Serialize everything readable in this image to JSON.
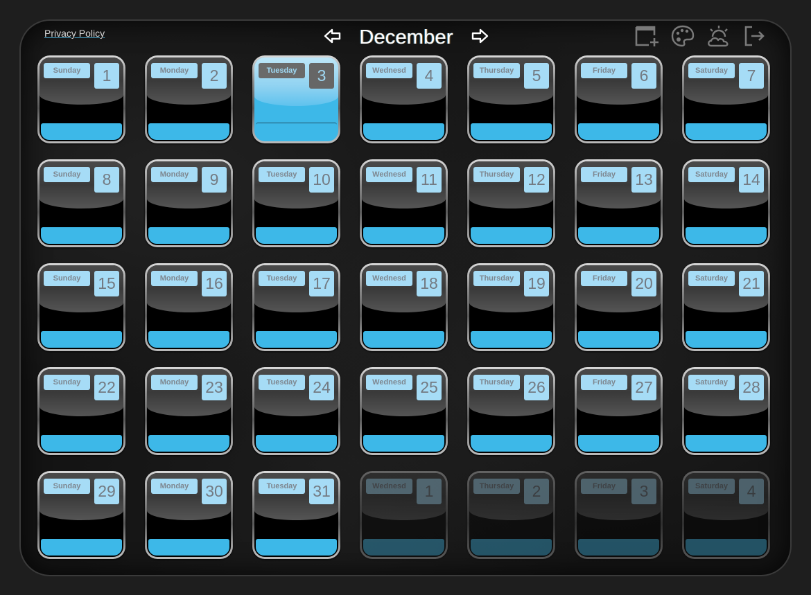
{
  "header": {
    "privacy_link": "Privacy Policy",
    "month": "December",
    "prev_icon": "arrow-left-outline-icon",
    "next_icon": "arrow-right-outline-icon"
  },
  "toolbar": [
    {
      "name": "add-calendar-button",
      "icon": "calendar-plus-icon",
      "label": "Add event"
    },
    {
      "name": "theme-button",
      "icon": "palette-icon",
      "label": "Theme"
    },
    {
      "name": "weather-button",
      "icon": "sun-cloud-icon",
      "label": "Weather"
    },
    {
      "name": "logout-button",
      "icon": "logout-icon",
      "label": "Log out"
    }
  ],
  "colors": {
    "accent": "#3db8e8",
    "label_bg": "#a6dcf6",
    "label_text": "#7e8790",
    "frame_bg": "#141414",
    "page_bg": "#1e1e1e"
  },
  "today": 3,
  "days": [
    {
      "weekday": "Sunday",
      "day": "1",
      "state": "current"
    },
    {
      "weekday": "Monday",
      "day": "2",
      "state": "current"
    },
    {
      "weekday": "Tuesday",
      "day": "3",
      "state": "today"
    },
    {
      "weekday": "Wednesd",
      "day": "4",
      "state": "current"
    },
    {
      "weekday": "Thursday",
      "day": "5",
      "state": "current"
    },
    {
      "weekday": "Friday",
      "day": "6",
      "state": "current"
    },
    {
      "weekday": "Saturday",
      "day": "7",
      "state": "current"
    },
    {
      "weekday": "Sunday",
      "day": "8",
      "state": "current"
    },
    {
      "weekday": "Monday",
      "day": "9",
      "state": "current"
    },
    {
      "weekday": "Tuesday",
      "day": "10",
      "state": "current"
    },
    {
      "weekday": "Wednesd",
      "day": "11",
      "state": "current"
    },
    {
      "weekday": "Thursday",
      "day": "12",
      "state": "current"
    },
    {
      "weekday": "Friday",
      "day": "13",
      "state": "current"
    },
    {
      "weekday": "Saturday",
      "day": "14",
      "state": "current"
    },
    {
      "weekday": "Sunday",
      "day": "15",
      "state": "current"
    },
    {
      "weekday": "Monday",
      "day": "16",
      "state": "current"
    },
    {
      "weekday": "Tuesday",
      "day": "17",
      "state": "current"
    },
    {
      "weekday": "Wednesd",
      "day": "18",
      "state": "current"
    },
    {
      "weekday": "Thursday",
      "day": "19",
      "state": "current"
    },
    {
      "weekday": "Friday",
      "day": "20",
      "state": "current"
    },
    {
      "weekday": "Saturday",
      "day": "21",
      "state": "current"
    },
    {
      "weekday": "Sunday",
      "day": "22",
      "state": "current"
    },
    {
      "weekday": "Monday",
      "day": "23",
      "state": "current"
    },
    {
      "weekday": "Tuesday",
      "day": "24",
      "state": "current"
    },
    {
      "weekday": "Wednesd",
      "day": "25",
      "state": "current"
    },
    {
      "weekday": "Thursday",
      "day": "26",
      "state": "current"
    },
    {
      "weekday": "Friday",
      "day": "27",
      "state": "current"
    },
    {
      "weekday": "Saturday",
      "day": "28",
      "state": "current"
    },
    {
      "weekday": "Sunday",
      "day": "29",
      "state": "current"
    },
    {
      "weekday": "Monday",
      "day": "30",
      "state": "current"
    },
    {
      "weekday": "Tuesday",
      "day": "31",
      "state": "current"
    },
    {
      "weekday": "Wednesd",
      "day": "1",
      "state": "other"
    },
    {
      "weekday": "Thursday",
      "day": "2",
      "state": "other"
    },
    {
      "weekday": "Friday",
      "day": "3",
      "state": "other"
    },
    {
      "weekday": "Saturday",
      "day": "4",
      "state": "other"
    }
  ]
}
